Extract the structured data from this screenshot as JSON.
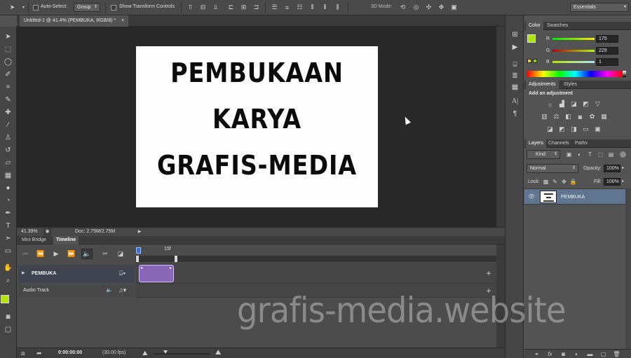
{
  "options_bar": {
    "auto_select_label": "Auto-Select:",
    "auto_select_value": "Group",
    "transform_label": "Show Transform Controls",
    "mode_3d_label": "3D Mode:",
    "workspace": "Essentials"
  },
  "document": {
    "tab_title": "Untitled-1 @ 41.4% (PEMBUKA, RGB/8) *",
    "close_glyph": "×",
    "lines": [
      "PEMBUKAAN",
      "KARYA",
      "GRAFIS-MEDIA"
    ],
    "zoom": "41.39%",
    "doc_size": "Doc: 2.75M/2.75M"
  },
  "timeline": {
    "tabs": [
      "Mini Bridge",
      "Timeline"
    ],
    "ruler_label": "15f",
    "tracks": [
      {
        "name": "PEMBUKA"
      },
      {
        "name": "Audio Track"
      }
    ],
    "timecode": "0:00:00:00",
    "fps": "(30.00 fps)"
  },
  "color_panel": {
    "tabs": [
      "Color",
      "Swatches"
    ],
    "channels": [
      {
        "label": "R",
        "value": "175"
      },
      {
        "label": "G",
        "value": "229"
      },
      {
        "label": "B",
        "value": "1"
      }
    ],
    "foreground_color": "#afe501"
  },
  "adjustments_panel": {
    "tabs": [
      "Adjustments",
      "Styles"
    ],
    "heading": "Add an adjustment"
  },
  "layers_panel": {
    "tabs": [
      "Layers",
      "Channels",
      "Paths"
    ],
    "kind_label": "Kind",
    "blend_mode": "Normal",
    "opacity_label": "Opacity:",
    "opacity_value": "100%",
    "lock_label": "Lock:",
    "fill_label": "Fill:",
    "fill_value": "100%",
    "layer_name": "PEMBUKA"
  },
  "watermark": "grafis-media.website"
}
